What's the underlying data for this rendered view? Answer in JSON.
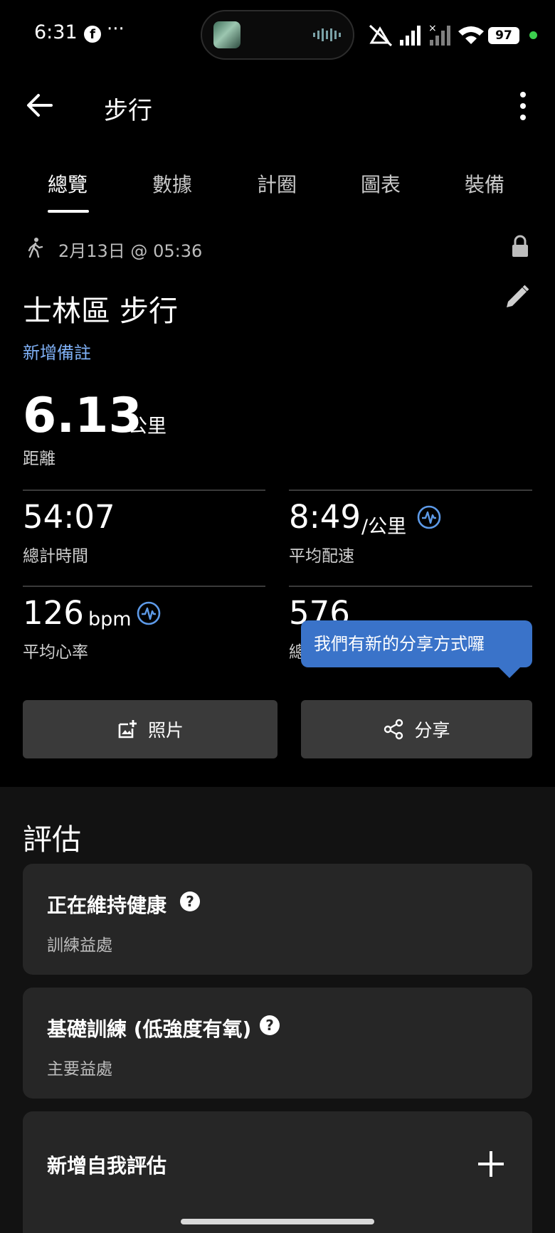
{
  "status_bar": {
    "time": "6:31",
    "facebook_glyph": "f",
    "more": "···",
    "battery": "97"
  },
  "header": {
    "title": "步行"
  },
  "tabs": [
    {
      "label": "總覽",
      "active": true
    },
    {
      "label": "數據"
    },
    {
      "label": "計圈"
    },
    {
      "label": "圖表"
    },
    {
      "label": "裝備"
    }
  ],
  "activity": {
    "date": "2月13日 @ 05:36",
    "title": "士林區 步行",
    "add_note": "新增備註"
  },
  "distance": {
    "value": "6.13",
    "unit": "公里",
    "label": "距離"
  },
  "stats": {
    "total_time": {
      "value": "54:07",
      "label": "總計時間"
    },
    "avg_pace": {
      "value": "8:49",
      "unit": "/公里",
      "label": "平均配速"
    },
    "avg_hr": {
      "value": "126",
      "unit": "bpm",
      "label": "平均心率"
    },
    "fourth": {
      "value": "576",
      "label": "總"
    }
  },
  "tooltip": {
    "text": "我們有新的分享方式囉"
  },
  "buttons": {
    "photos": "照片",
    "share": "分享"
  },
  "evaluation": {
    "heading": "評估",
    "cards": [
      {
        "title": "正在維持健康",
        "subtitle": "訓練益處"
      },
      {
        "title": "基礎訓練 (低強度有氧)",
        "subtitle": "主要益處"
      }
    ],
    "add_self_assessment": "新增自我評估"
  },
  "colors": {
    "accent_link": "#7fb0f5",
    "tooltip": "#3a73c9",
    "button_bg": "#3a3a3a",
    "card_bg": "#262626"
  },
  "icons": [
    "back-arrow-icon",
    "overflow-menu-icon",
    "walk-icon",
    "lock-icon",
    "edit-pencil-icon",
    "heart-rate-icon",
    "add-photo-icon",
    "share-icon",
    "help-icon",
    "plus-icon"
  ]
}
